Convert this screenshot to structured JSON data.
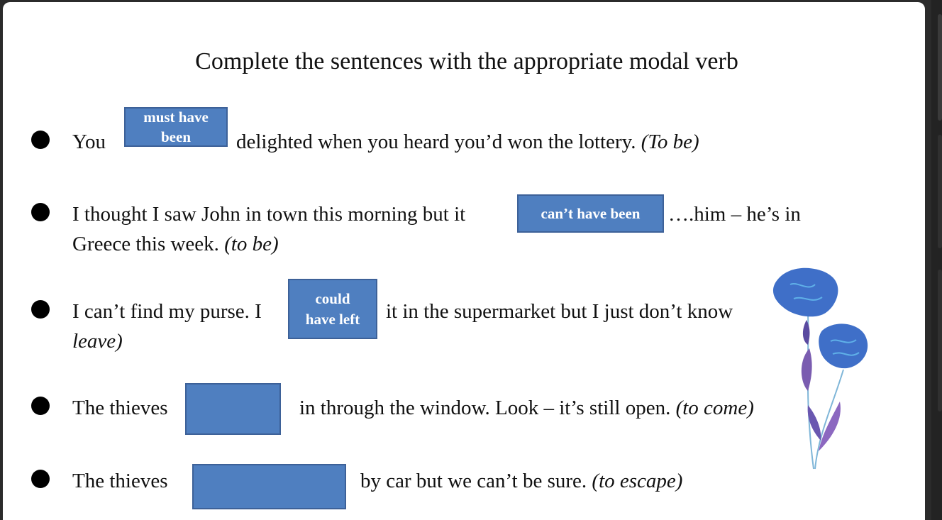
{
  "title": "Complete the sentences with the appropriate modal verb",
  "sentences": [
    {
      "before": "You",
      "answer_line1": "must have",
      "answer_line2": "been",
      "after": "delighted when you heard you’d won the lottery.",
      "hint": "(To be)"
    },
    {
      "before": "I thought I saw John in town this morning but it",
      "answer": "can’t have been",
      "after": "….him – he’s in",
      "line2": "Greece this week.",
      "hint": "(to be)"
    },
    {
      "before": "I can’t find my purse. I",
      "answer_line1": "could",
      "answer_line2": "have left",
      "after": "it in the supermarket but I just don’t know",
      "line2_hint": "leave)"
    },
    {
      "before": "The thieves",
      "answer": "",
      "after": "in through the window. Look – it’s still open.",
      "hint": "(to come)"
    },
    {
      "before": "The thieves",
      "answer": "",
      "after": "by car but we can’t be sure.",
      "hint": "(to escape)"
    }
  ],
  "colors": {
    "answer_box": "#4f7fc0",
    "answer_border": "#3d6198",
    "flower": "#3f6fc8",
    "stem": "#7a5cb0"
  },
  "decoration_icon": "blue-flower-illustration"
}
